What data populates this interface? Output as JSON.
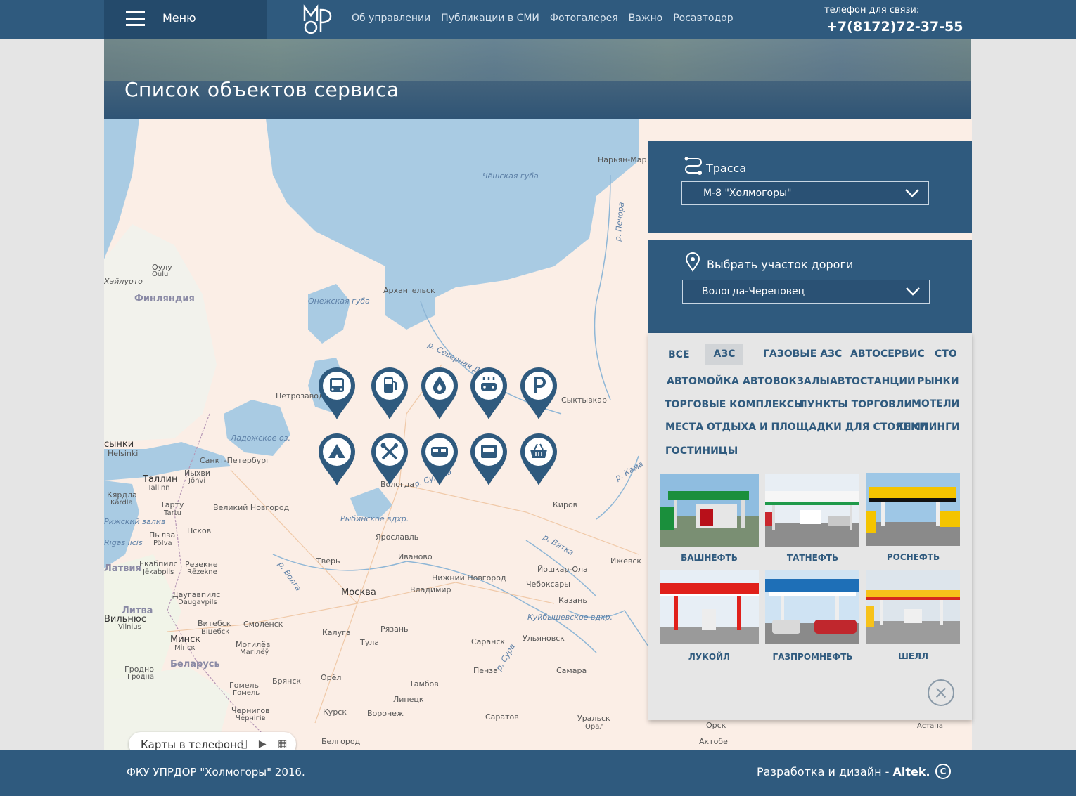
{
  "header": {
    "menu_label": "Меню",
    "nav": [
      "Об управлении",
      "Публикации в СМИ",
      "Фотогалерея",
      "Важно",
      "Росавтодор"
    ],
    "phone_label": "телефон для связи:",
    "phone": "+7(8172)72-37-55"
  },
  "page": {
    "title": "Список объектов сервиса"
  },
  "map": {
    "cities": [
      {
        "label": "Нарьян-Мар"
      },
      {
        "label": "Оулу"
      },
      {
        "label": "Oulu"
      },
      {
        "label": "Финляндия"
      },
      {
        "label": "Архангельск"
      },
      {
        "label": "Петрозаводск"
      },
      {
        "label": "Сыктывкар"
      },
      {
        "label": "Хельсинки"
      },
      {
        "label": "Helsinki"
      },
      {
        "label": "Санкт-Петербург"
      },
      {
        "label": "Таллин"
      },
      {
        "label": "Tallinn"
      },
      {
        "label": "Йыхви"
      },
      {
        "label": "Jõhvi"
      },
      {
        "label": "Кярдла"
      },
      {
        "label": "Kärdla"
      },
      {
        "label": "Тарту"
      },
      {
        "label": "Tartu"
      },
      {
        "label": "Великий Новгород"
      },
      {
        "label": "Вологда"
      },
      {
        "label": "Киров"
      },
      {
        "label": "Псков"
      },
      {
        "label": "Пылва"
      },
      {
        "label": "Põlva"
      },
      {
        "label": "Ярославль"
      },
      {
        "label": "Тверь"
      },
      {
        "label": "Иваново"
      },
      {
        "label": "Ижевск"
      },
      {
        "label": "Екабпилс"
      },
      {
        "label": "Jēkabpils"
      },
      {
        "label": "Резекне"
      },
      {
        "label": "Rēzekne"
      },
      {
        "label": "Йошкар-Ола"
      },
      {
        "label": "Нижний Новгород"
      },
      {
        "label": "Чебоксары"
      },
      {
        "label": "Москва"
      },
      {
        "label": "Владимир"
      },
      {
        "label": "Даугавпилс"
      },
      {
        "label": "Daugavpils"
      },
      {
        "label": "Казань"
      },
      {
        "label": "Литва"
      },
      {
        "label": "Вильнюс"
      },
      {
        "label": "Vilnius"
      },
      {
        "label": "Витебск"
      },
      {
        "label": "Віцебск"
      },
      {
        "label": "Смоленск"
      },
      {
        "label": "Рязань"
      },
      {
        "label": "Калуга"
      },
      {
        "label": "Минск"
      },
      {
        "label": "Мінск"
      },
      {
        "label": "Могилёв"
      },
      {
        "label": "Магілёў"
      },
      {
        "label": "Тула"
      },
      {
        "label": "Саранск"
      },
      {
        "label": "Ульяновск"
      },
      {
        "label": "Беларусь"
      },
      {
        "label": "Гродно"
      },
      {
        "label": "Гродна"
      },
      {
        "label": "Орёл"
      },
      {
        "label": "Пенза"
      },
      {
        "label": "Самара"
      },
      {
        "label": "Гомель"
      },
      {
        "label": "Гомель"
      },
      {
        "label": "Брянск"
      },
      {
        "label": "Тамбов"
      },
      {
        "label": "Липецк"
      },
      {
        "label": "Чернигов"
      },
      {
        "label": "Чернігів"
      },
      {
        "label": "Курск"
      },
      {
        "label": "Воронеж"
      },
      {
        "label": "Саратов"
      },
      {
        "label": "Уральск"
      },
      {
        "label": "Орал"
      },
      {
        "label": "Орск"
      },
      {
        "label": "Белгород"
      },
      {
        "label": "Актобе"
      },
      {
        "label": "Астана"
      },
      {
        "label": "Латвия"
      },
      {
        "label": "сынки"
      },
      {
        "label": "Хайлуото"
      },
      {
        "label": "Рижский залив"
      },
      {
        "label": "Rīgas līcis"
      }
    ],
    "water": [
      {
        "label": "Чёшская губа"
      },
      {
        "label": "р. Печора"
      },
      {
        "label": "Онежская губа"
      },
      {
        "label": "р. Северная Двина"
      },
      {
        "label": "Ладожское оз."
      },
      {
        "label": "р. Кама"
      },
      {
        "label": "Рыбинское вдхр."
      },
      {
        "label": "р. Вятка"
      },
      {
        "label": "р. Волга"
      },
      {
        "label": "Куйбышевское вдхр."
      },
      {
        "label": "р. Сура"
      },
      {
        "label": "р. Сухона"
      }
    ],
    "pins": [
      {
        "name": "bus-pin",
        "icon": "bus"
      },
      {
        "name": "fuel-pin",
        "icon": "fuel-pump"
      },
      {
        "name": "gas-pin",
        "icon": "gas-drop"
      },
      {
        "name": "car-wash-pin",
        "icon": "car-wash"
      },
      {
        "name": "parking-pin",
        "icon": "parking"
      },
      {
        "name": "camping-pin",
        "icon": "tent"
      },
      {
        "name": "service-pin",
        "icon": "wrench-screwdriver"
      },
      {
        "name": "hotel-pin",
        "icon": "bed"
      },
      {
        "name": "market-pin",
        "icon": "store"
      },
      {
        "name": "shop-pin",
        "icon": "basket"
      }
    ],
    "mobile_maps": "Карты в телефоне"
  },
  "route": {
    "label": "Трасса",
    "value": "М-8 \"Холмогоры\""
  },
  "section": {
    "label": "Выбрать участок дороги",
    "value": "Вологда-Череповец"
  },
  "filters": [
    {
      "label": "ВСЕ",
      "active": false
    },
    {
      "label": "АЗС",
      "active": true
    },
    {
      "label": "ГАЗОВЫЕ АЗС",
      "active": false
    },
    {
      "label": "АВТОСЕРВИС",
      "active": false
    },
    {
      "label": "СТО",
      "active": false
    },
    {
      "label": "АВТОМОЙКА",
      "active": false
    },
    {
      "label": "АВТОВОКЗАЛЫ",
      "active": false
    },
    {
      "label": "АВТОСТАНЦИИ",
      "active": false
    },
    {
      "label": "РЫНКИ",
      "active": false
    },
    {
      "label": "ТОРГОВЫЕ КОМПЛЕКСЫ",
      "active": false
    },
    {
      "label": "ПУНКТЫ ТОРГОВЛИ",
      "active": false
    },
    {
      "label": "МОТЕЛИ",
      "active": false
    },
    {
      "label": "МЕСТА ОТДЫХА И ПЛОЩАДКИ ДЛЯ СТОЯНКИ",
      "active": false
    },
    {
      "label": "КЕМПИНГИ",
      "active": false
    },
    {
      "label": "ГОСТИНИЦЫ",
      "active": false
    }
  ],
  "brands": [
    {
      "name": "БАШНЕФТЬ",
      "color": "#1a8f3c"
    },
    {
      "name": "ТАТНЕФТЬ",
      "color": "#1f9a4a"
    },
    {
      "name": "РОСНЕФТЬ",
      "color": "#f4c400"
    },
    {
      "name": "ЛУКОЙЛ",
      "color": "#e0201b"
    },
    {
      "name": "ГАЗПРОМНЕФТЬ",
      "color": "#1e6fb7"
    },
    {
      "name": "ШЕЛЛ",
      "color": "#f7c21a"
    }
  ],
  "footer": {
    "copyright": "ФКУ УПРДОР \"Холмогоры\" 2016.",
    "dev_prefix": "Разработка и дизайн - ",
    "dev_name": "Aitek.",
    "copy_symbol": "C"
  },
  "colors": {
    "primary": "#2f5a7e",
    "dark": "#244a6b",
    "panel_bg": "#e6e6e6"
  }
}
